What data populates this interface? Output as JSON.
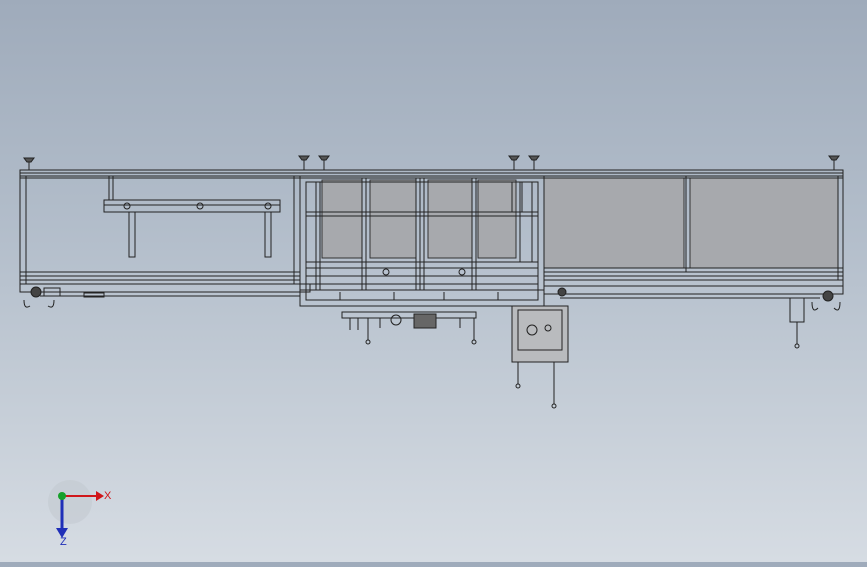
{
  "viewport": {
    "background_top": "#9fabbb",
    "background_bottom": "#d6dce3",
    "line_color": "#222222",
    "panel_fill": "#a7a9ad"
  },
  "triad": {
    "x_label": "X",
    "z_label": "Z",
    "x_color": "#d0161a",
    "y_color": "#16a02a",
    "z_color": "#1f2fb8"
  }
}
